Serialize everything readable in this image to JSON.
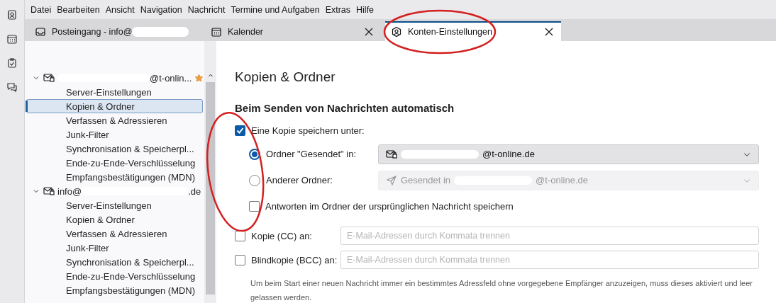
{
  "menu": [
    {
      "label": "Datei"
    },
    {
      "label": "Bearbeiten"
    },
    {
      "label": "Ansicht"
    },
    {
      "label": "Navigation"
    },
    {
      "label": "Nachricht"
    },
    {
      "label": "Termine und Aufgaben"
    },
    {
      "label": "Extras"
    },
    {
      "label": "Hilfe"
    }
  ],
  "spaces": [
    {
      "kind": "contacts"
    },
    {
      "kind": "calendar"
    },
    {
      "kind": "tasks"
    },
    {
      "kind": "chat"
    }
  ],
  "tabs": [
    {
      "label": "Posteingang - info@",
      "kind": "inbox",
      "selected": false,
      "closable": false,
      "redacted": true
    },
    {
      "label": "Kalender",
      "kind": "calendar",
      "selected": false,
      "closable": true,
      "redacted": false
    },
    {
      "label": "Konten-Einstellungen",
      "kind": "account",
      "selected": true,
      "closable": true,
      "redacted": false
    }
  ],
  "accounts": [
    {
      "name_end": "@t-onlin...",
      "default": true,
      "expanded": true,
      "children": [
        {
          "label": "Server-Einstellungen",
          "selected": false
        },
        {
          "label": "Kopien & Ordner",
          "selected": true
        },
        {
          "label": "Verfassen & Adressieren",
          "selected": false
        },
        {
          "label": "Junk-Filter",
          "selected": false
        },
        {
          "label": "Synchronisation & Speicherpl...",
          "selected": false
        },
        {
          "label": "Ende-zu-Ende-Verschlüsselung",
          "selected": false
        },
        {
          "label": "Empfangsbestätigungen (MDN)",
          "selected": false
        }
      ]
    },
    {
      "name_start": "info@",
      "name_end": ".de",
      "default": false,
      "expanded": true,
      "children": [
        {
          "label": "Server-Einstellungen",
          "selected": false
        },
        {
          "label": "Kopien & Ordner",
          "selected": false
        },
        {
          "label": "Verfassen & Adressieren",
          "selected": false
        },
        {
          "label": "Junk-Filter",
          "selected": false
        },
        {
          "label": "Synchronisation & Speicherpl...",
          "selected": false
        },
        {
          "label": "Ende-zu-Ende-Verschlüsselung",
          "selected": false
        },
        {
          "label": "Empfangsbestätigungen (MDN)",
          "selected": false
        }
      ]
    }
  ],
  "page": {
    "title": "Kopien & Ordner",
    "section": "Beim Senden von Nachrichten automatisch",
    "save_copy": {
      "label": "Eine Kopie speichern unter:",
      "checked": true
    },
    "targets": [
      {
        "label": "Ordner \"Gesendet\" in:",
        "selected": true,
        "dropdown": {
          "kind": "account",
          "value_end": "@t-online.de",
          "disabled": false
        }
      },
      {
        "label": "Anderer Ordner:",
        "selected": false,
        "dropdown": {
          "kind": "folder",
          "value_start": "Gesendet in",
          "value_end": "@t-online.de",
          "disabled": true
        }
      }
    ],
    "replies": {
      "label": "Antworten im Ordner der ursprünglichen Nachricht speichern",
      "checked": false
    },
    "recipients": [
      {
        "label": "Kopie (CC) an:",
        "checked": false,
        "placeholder": "E-Mail-Adressen durch Kommata trennen"
      },
      {
        "label": "Blindkopie (BCC) an:",
        "checked": false,
        "placeholder": "E-Mail-Adressen durch Kommata trennen"
      }
    ],
    "note": "Um beim Start einer neuen Nachricht immer ein bestimmtes Adressfeld ohne vorgegebene Empfänger anzuzeigen, muss dieses aktiviert und leer gelassen werden."
  }
}
